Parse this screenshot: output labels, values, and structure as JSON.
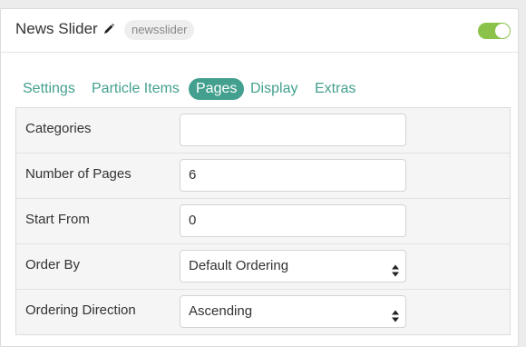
{
  "widget": {
    "title": "News Slider",
    "badge": "newsslider",
    "enabled": true,
    "accent_color": "#43a08f",
    "toggle_color": "#8bc34a"
  },
  "tabs": [
    {
      "label": "Settings",
      "active": false
    },
    {
      "label": "Particle Items",
      "active": false
    },
    {
      "label": "Pages",
      "active": true
    },
    {
      "label": "Display",
      "active": false
    },
    {
      "label": "Extras",
      "active": false
    }
  ],
  "fields": {
    "categories": {
      "label": "Categories",
      "value": ""
    },
    "number_of_pages": {
      "label": "Number of Pages",
      "value": "6"
    },
    "start_from": {
      "label": "Start From",
      "value": "0"
    },
    "order_by": {
      "label": "Order By",
      "value": "Default Ordering"
    },
    "ordering_direction": {
      "label": "Ordering Direction",
      "value": "Ascending"
    }
  }
}
